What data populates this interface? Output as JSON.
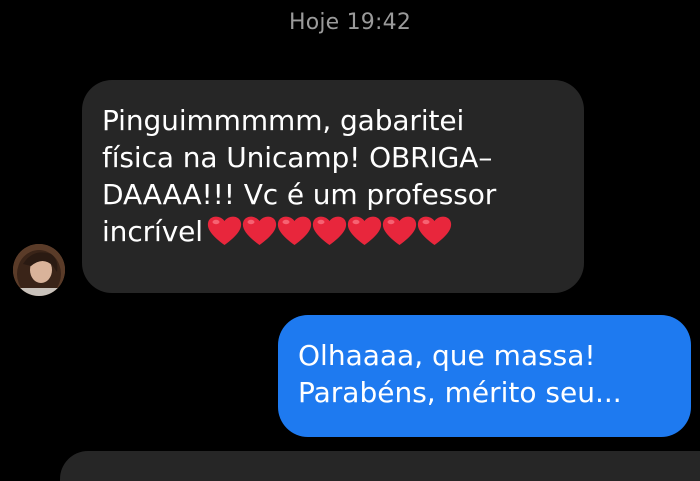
{
  "thread": {
    "timestamp": "Hoje 19:42"
  },
  "messages": {
    "received": {
      "lines": [
        "Pinguimmmmm, gabaritei",
        "física na Unicamp! OBRIGA–",
        "DAAAA!!! Vc é um professor",
        "incrível"
      ],
      "emoji": "heart",
      "emoji_count": 7,
      "bubble_color": "#262626",
      "sender_avatar": "avatar"
    },
    "sent": {
      "lines": [
        "Olhaaaa, que massa!",
        "Parabéns, mérito seu..."
      ],
      "bubble_color": "#1e7af0"
    }
  },
  "colors": {
    "background": "#000000",
    "timestamp": "#9a9a9a",
    "heart": "#e8263c"
  }
}
